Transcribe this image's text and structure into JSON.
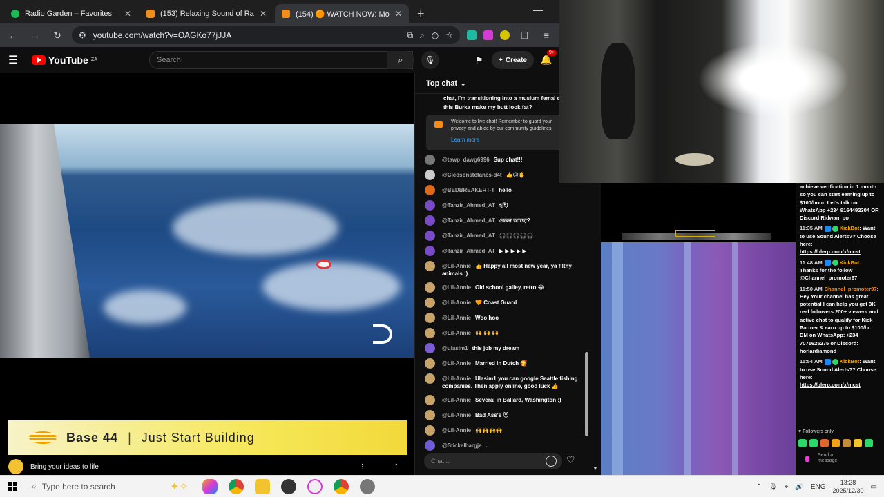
{
  "browser": {
    "tabs": [
      {
        "title": "Radio Garden – Favorites",
        "favicon_color": "#1db954"
      },
      {
        "title": "(153) Relaxing Sound of Ra",
        "favicon_color": "#f28c1a"
      },
      {
        "title": "(154) 🟠 WATCH NOW: Mo",
        "favicon_color": "#f28c1a"
      }
    ],
    "url": "youtube.com/watch?v=OAGKo77jJJA"
  },
  "youtube": {
    "logo_text": "YouTube",
    "region": "ZA",
    "search_placeholder": "Search",
    "create_label": "Create",
    "notif_count": "9+"
  },
  "ad": {
    "brand": "Base 44",
    "separator": "|",
    "tagline": "Just Start Building",
    "subline": "Bring your ideas to life"
  },
  "chat": {
    "header": "Top chat",
    "pinned": "chat, I'm transitioning into a muslum femal does this Burka make my butt look fat?",
    "welcome": "Welcome to live chat! Remember to guard your privacy and abide by our community guidelines",
    "learn_more": "Learn more",
    "input_placeholder": "Chat...",
    "messages": [
      {
        "author": "@tawp_dawg6996",
        "text": "Sup chat!!!",
        "avatar": "#777777"
      },
      {
        "author": "@Cledsonstefanes-d4t",
        "text": "👍😐✋",
        "avatar": "#cccccc"
      },
      {
        "author": "@BEDBREAKERT-T",
        "text": "hello",
        "avatar": "#e0681a"
      },
      {
        "author": "@Tanzir_Ahmed_AT",
        "text": "হাই!",
        "avatar": "#7a4bc8"
      },
      {
        "author": "@Tanzir_Ahmed_AT",
        "text": "কেমন আছো?",
        "avatar": "#7a4bc8"
      },
      {
        "author": "@Tanzir_Ahmed_AT",
        "text": "🎧🎧🎧🎧🎧",
        "avatar": "#7a4bc8"
      },
      {
        "author": "@Tanzir_Ahmed_AT",
        "text": "▶ ▶ ▶ ▶ ▶",
        "avatar": "#7a4bc8"
      },
      {
        "author": "@Lil-Annie",
        "text": "👍 Happy all most new year, ya filthy animals ;)",
        "avatar": "#c8a46a"
      },
      {
        "author": "@Lil-Annie",
        "text": "Old school galley, retro 😂",
        "avatar": "#c8a46a"
      },
      {
        "author": "@Lil-Annie",
        "text": "🧡 Coast Guard",
        "avatar": "#c8a46a"
      },
      {
        "author": "@Lil-Annie",
        "text": "Woo hoo",
        "avatar": "#c8a46a"
      },
      {
        "author": "@Lil-Annie",
        "text": "🙌 🙌 🙌",
        "avatar": "#c8a46a"
      },
      {
        "author": "@ulasim1",
        "text": "this job my dream",
        "avatar": "#7b5bd6"
      },
      {
        "author": "@Lil-Annie",
        "text": "Married in Dutch 🥰",
        "avatar": "#c8a46a"
      },
      {
        "author": "@Lil-Annie",
        "text": "Ulasim1 you can google Seattle fishing companies. Then apply online, good luck 👍",
        "avatar": "#c8a46a"
      },
      {
        "author": "@Lil-Annie",
        "text": "Several in Ballard, Washington ;)",
        "avatar": "#c8a46a"
      },
      {
        "author": "@Lil-Annie",
        "text": "Bad Ass's 😈",
        "avatar": "#c8a46a"
      },
      {
        "author": "@Lil-Annie",
        "text": "🙌🙌🙌🙌",
        "avatar": "#c8a46a"
      },
      {
        "author": "@Stickelbargje",
        "text": ".",
        "avatar": "#6f5bd6"
      }
    ]
  },
  "kick": {
    "top_text": "achieve verification in 1 month so you can start earning up to $100/hour. Let's talk on WhatsApp +234 9164492304 OR Discord Ridwan_po",
    "messages": [
      {
        "time": "11:35 AM",
        "user": "KickBot",
        "text": "Want to use Sound Alerts?? Choose here:",
        "link": "https://blerp.com/x/mcst"
      },
      {
        "time": "11:48 AM",
        "user": "KickBot",
        "text": "Thanks for the follow @Channel_promoter97",
        "link": ""
      },
      {
        "time": "11:50 AM",
        "user": "Channel_promoter97",
        "text": "Hey Your channel has great potential I can help you get 3K real followers 200+ viewers and active chat to qualify for Kick Partner & earn up to $100/hr. DM on WhatsApp: +234 7071625275 or Discord: horlardiamond",
        "link": ""
      },
      {
        "time": "11:54 AM",
        "user": "KickBot",
        "text": "Want to use Sound Alerts?? Choose here:",
        "link": "https://blerp.com/x/mcst"
      }
    ],
    "followers_only": "Followers only",
    "send_placeholder": "Send a message"
  },
  "taskbar": {
    "search_placeholder": "Type here to search",
    "lang": "ENG",
    "time": "13:28",
    "date": "2025/12/30"
  }
}
